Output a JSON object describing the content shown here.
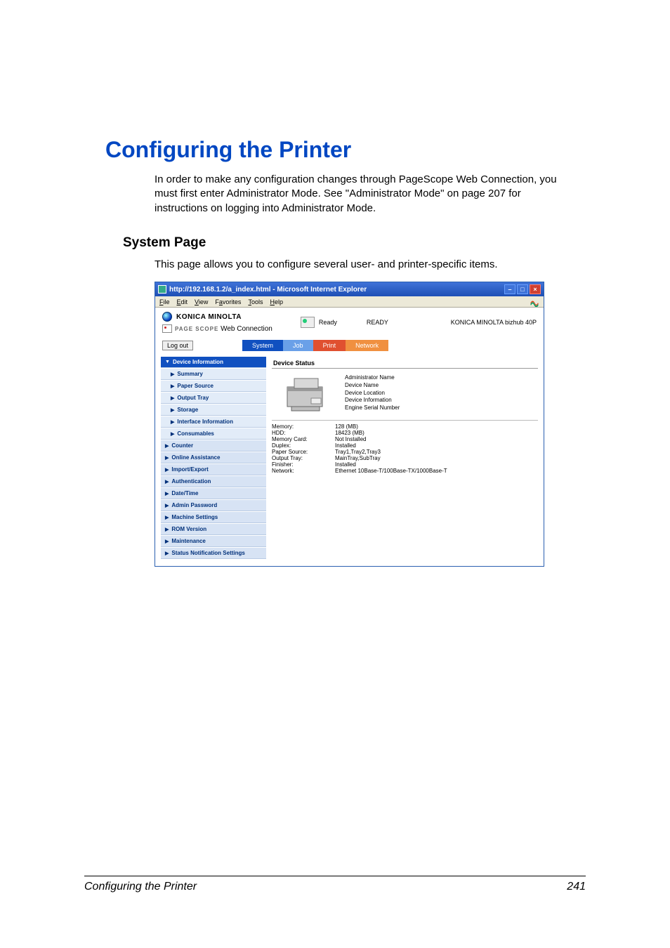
{
  "heading": "Configuring the Printer",
  "intro": "In order to make any configuration changes through PageScope Web Connection, you must first enter Administrator Mode. See \"Administrator Mode\" on page 207 for instructions on logging into Administrator Mode.",
  "section": "System Page",
  "section_body": "This page allows you to configure several user- and printer-specific items.",
  "footer_title": "Configuring the Printer",
  "page_number": "241",
  "ie": {
    "title": "http://192.168.1.2/a_index.html - Microsoft Internet Explorer",
    "menu": {
      "file": "File",
      "edit": "Edit",
      "view": "View",
      "fav": "Favorites",
      "tools": "Tools",
      "help": "Help"
    }
  },
  "brand": {
    "name": "KONICA MINOLTA",
    "ps_small": "PAGE SCOPE",
    "ps_text": "Web Connection"
  },
  "status": {
    "label": "Ready",
    "value": "READY",
    "model": "KONICA MINOLTA bizhub 40P"
  },
  "logout": "Log out",
  "tabs": {
    "system": "System",
    "job": "Job",
    "print": "Print",
    "network": "Network"
  },
  "sidebar": {
    "header": "Device Information",
    "items": [
      {
        "label": "Summary",
        "sub": true
      },
      {
        "label": "Paper Source",
        "sub": true
      },
      {
        "label": "Output Tray",
        "sub": true
      },
      {
        "label": "Storage",
        "sub": true
      },
      {
        "label": "Interface Information",
        "sub": true
      },
      {
        "label": "Consumables",
        "sub": true
      },
      {
        "label": "Counter",
        "sub": false
      },
      {
        "label": "Online Assistance",
        "sub": false
      },
      {
        "label": "Import/Export",
        "sub": false
      },
      {
        "label": "Authentication",
        "sub": false
      },
      {
        "label": "Date/Time",
        "sub": false
      },
      {
        "label": "Admin Password",
        "sub": false
      },
      {
        "label": "Machine Settings",
        "sub": false
      },
      {
        "label": "ROM Version",
        "sub": false
      },
      {
        "label": "Maintenance",
        "sub": false
      },
      {
        "label": "Status Notification Settings",
        "sub": false
      }
    ]
  },
  "panel": {
    "title": "Device Status",
    "info": {
      "administrator_name": "Administrator Name",
      "device_name": "Device Name",
      "device_location": "Device Location",
      "device_information": "Device Information",
      "engine_serial": "Engine Serial Number"
    },
    "specs": [
      {
        "k": "Memory:",
        "v": "128 (MB)"
      },
      {
        "k": "HDD:",
        "v": "18423 (MB)"
      },
      {
        "k": "Memory Card:",
        "v": "Not Installed"
      },
      {
        "k": "Duplex:",
        "v": "Installed"
      },
      {
        "k": "Paper Source:",
        "v": "Tray1,Tray2,Tray3"
      },
      {
        "k": "Output Tray:",
        "v": "MainTray,SubTray"
      },
      {
        "k": "Finisher:",
        "v": "Installed"
      },
      {
        "k": "Network:",
        "v": "Ethernet 10Base-T/100Base-TX/1000Base-T"
      }
    ]
  }
}
